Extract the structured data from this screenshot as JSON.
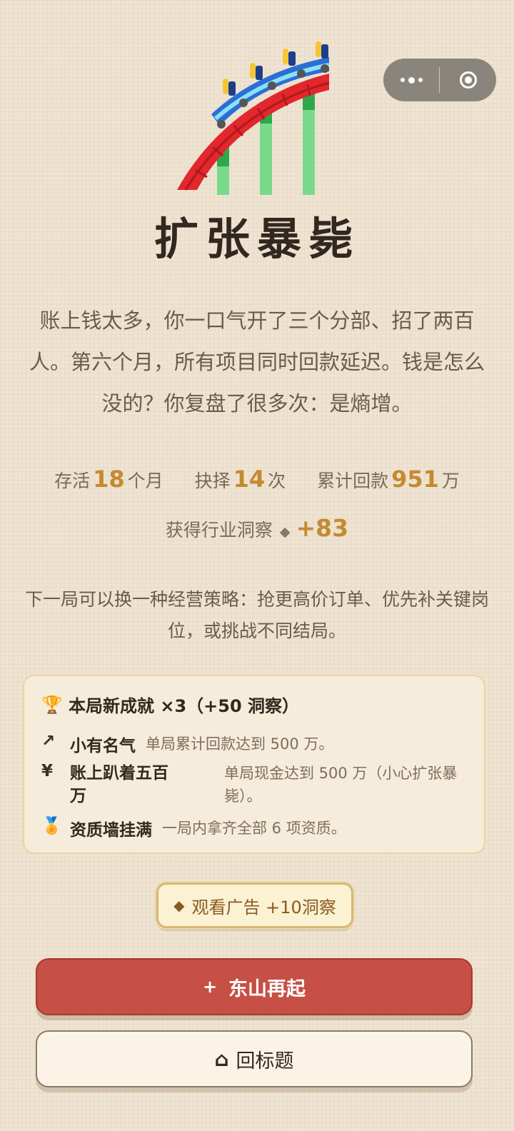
{
  "capsule": {
    "more_icon": "more-dots-icon",
    "close_icon": "close-target-icon"
  },
  "hero": {
    "icon": "roller-coaster-icon"
  },
  "title": "扩张暴毙",
  "story": "账上钱太多，你一口气开了三个分部、招了两百人。第六个月，所有项目同时回款延迟。钱是怎么没的？你复盘了很多次：是熵增。",
  "stats": {
    "survive_label": "存活",
    "survive_value": "18",
    "survive_unit": "个月",
    "choice_label": "抉择",
    "choice_value": "14",
    "choice_unit": "次",
    "payback_label": "累计回款",
    "payback_value": "951",
    "payback_unit": "万"
  },
  "insight": {
    "label": "获得行业洞察",
    "icon": "diamond-icon",
    "value": "+83"
  },
  "hint": "下一局可以换一种经营策略：抢更高价订单、优先补关键岗位，或挑战不同结局。",
  "achievements": {
    "header": "本局新成就 ×3（+50 洞察）",
    "header_icon": "trophy-icon",
    "items": [
      {
        "icon": "↗",
        "icon_name": "trend-up-icon",
        "name": "小有名气",
        "desc": "单局累计回款达到 500 万。"
      },
      {
        "icon": "¥",
        "icon_name": "yen-icon",
        "name": "账上趴着五百万",
        "desc": "单局现金达到 500 万（小心扩张暴毙）。"
      },
      {
        "icon": "🏅",
        "icon_name": "medal-icon",
        "name": "资质墙挂满",
        "desc": "一局内拿齐全部 6 项资质。"
      }
    ]
  },
  "ad_button": {
    "icon": "◆",
    "label": "观看广告 +10洞察"
  },
  "restart_button": {
    "icon": "+",
    "label": "东山再起"
  },
  "home_button": {
    "icon": "⌂",
    "label": "回标题"
  },
  "colors": {
    "accent": "#c58a2f",
    "primary": "#c65045",
    "background": "#efe4d2"
  }
}
